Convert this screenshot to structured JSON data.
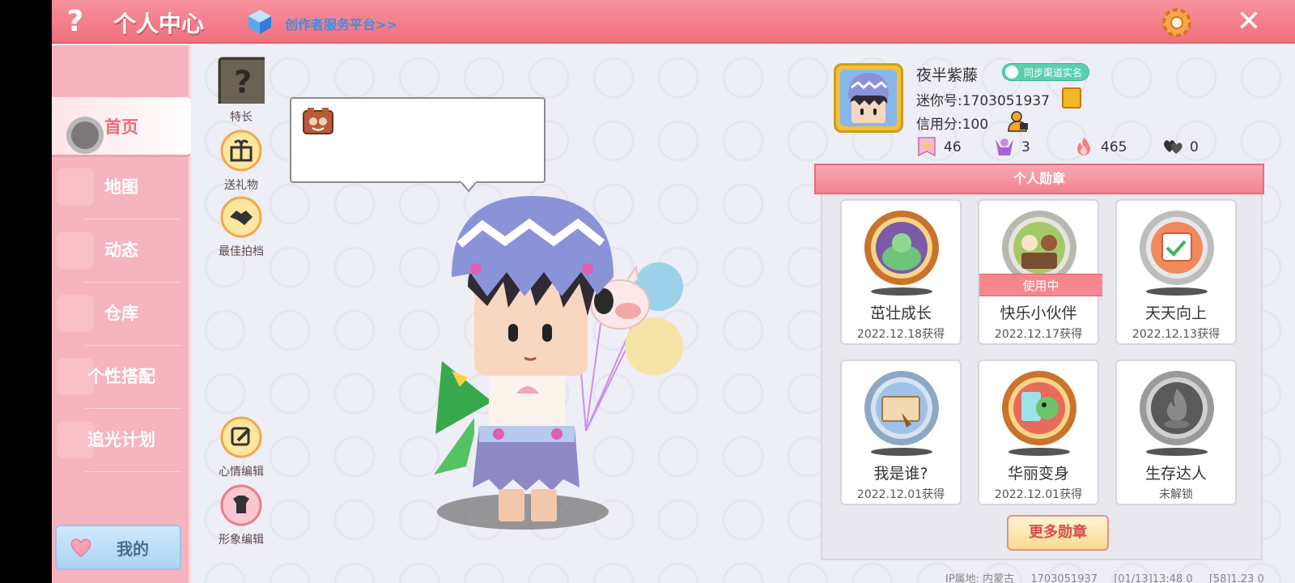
{
  "header": {
    "help_label": "?",
    "title": "个人中心",
    "creator_link": "创作者服务平台>>",
    "close_label": "✕"
  },
  "sidebar": {
    "items": [
      {
        "label": "首页",
        "active": true
      },
      {
        "label": "地图"
      },
      {
        "label": "动态"
      },
      {
        "label": "仓库"
      },
      {
        "label": "个性搭配"
      },
      {
        "label": "追光计划"
      }
    ],
    "mine_label": "我的"
  },
  "actions": {
    "specialty": "特长",
    "send_gift": "送礼物",
    "best_partner": "最佳拍档",
    "mood_edit": "心情编辑",
    "avatar_edit": "形象编辑"
  },
  "profile": {
    "nickname": "夜半紫藤",
    "verify_badge": "同步渠道实名",
    "uid_text": "迷你号:1703051937",
    "credit_text": "信用分:100",
    "stats": [
      {
        "icon": "plus-flag-icon",
        "value": "46"
      },
      {
        "icon": "cheer-icon",
        "value": "3"
      },
      {
        "icon": "fire-icon",
        "value": "465"
      },
      {
        "icon": "hearts-icon",
        "value": "0"
      }
    ]
  },
  "medals": {
    "title": "个人勋章",
    "cards": [
      {
        "name": "茁壮成长",
        "date": "2022.12.18获得",
        "in_use": false,
        "locked": false,
        "color": "#c8742a"
      },
      {
        "name": "快乐小伙伴",
        "date": "2022.12.17获得",
        "in_use": true,
        "in_use_label": "使用中",
        "locked": false,
        "color": "#b8b8b0"
      },
      {
        "name": "天天向上",
        "date": "2022.12.13获得",
        "in_use": false,
        "locked": false,
        "color": "#bdbdbd"
      },
      {
        "name": "我是谁?",
        "date": "2022.12.01获得",
        "in_use": false,
        "locked": false,
        "color": "#8ea7c4"
      },
      {
        "name": "华丽变身",
        "date": "2022.12.01获得",
        "in_use": false,
        "locked": false,
        "color": "#c8742a"
      },
      {
        "name": "生存达人",
        "date": "未解锁",
        "in_use": false,
        "locked": true,
        "color": "#9a9a9a"
      }
    ],
    "more_label": "更多勋章"
  },
  "footer": {
    "ip": "IP属地: 内蒙古",
    "uid": "1703051937",
    "time": "[01/13]13:48 0",
    "misc": "[58]1.23 0"
  },
  "colors": {
    "header": "#f0707d",
    "sidebar": "#f6b4be",
    "accent": "#f06b78",
    "link": "#3b8fe6"
  }
}
